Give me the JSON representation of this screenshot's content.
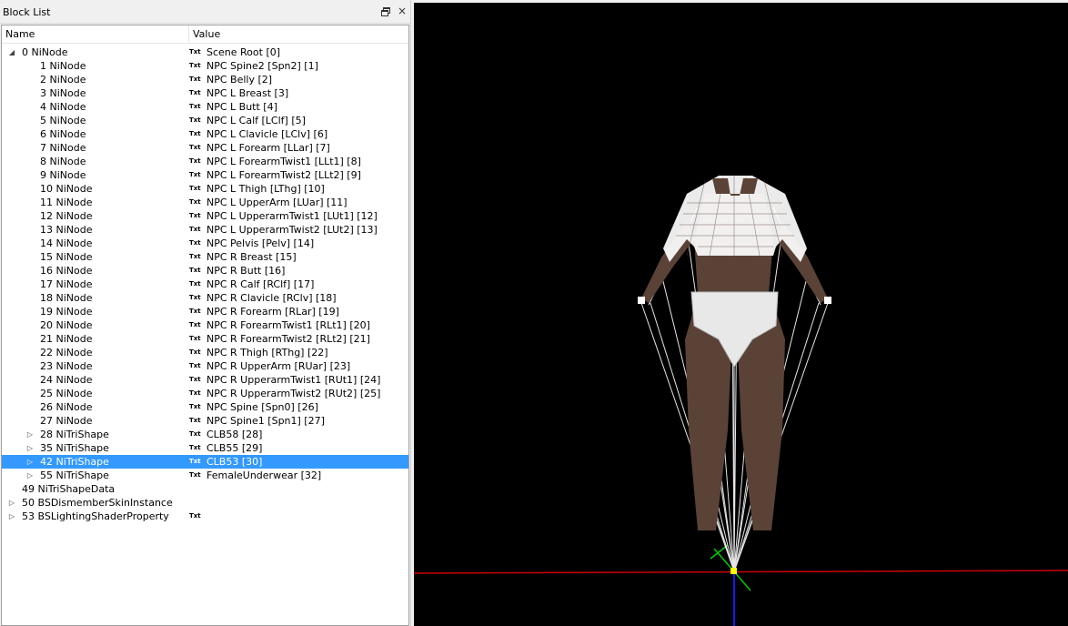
{
  "panel": {
    "title": "Block List",
    "float_icon": "restore-window-icon",
    "close_icon": "close-icon",
    "close_glyph": "×"
  },
  "tree": {
    "columns": {
      "name": "Name",
      "value": "Value"
    },
    "txt_badge": "Txt",
    "rows": [
      {
        "name": "0 NiNode",
        "value": "Scene Root [0]",
        "txt": true,
        "level": 0,
        "arrow": "expanded"
      },
      {
        "name": "1 NiNode",
        "value": "NPC Spine2 [Spn2] [1]",
        "txt": true,
        "level": 1
      },
      {
        "name": "2 NiNode",
        "value": "NPC Belly [2]",
        "txt": true,
        "level": 1
      },
      {
        "name": "3 NiNode",
        "value": "NPC L Breast [3]",
        "txt": true,
        "level": 1
      },
      {
        "name": "4 NiNode",
        "value": "NPC L Butt [4]",
        "txt": true,
        "level": 1
      },
      {
        "name": "5 NiNode",
        "value": "NPC L Calf [LClf] [5]",
        "txt": true,
        "level": 1
      },
      {
        "name": "6 NiNode",
        "value": "NPC L Clavicle [LClv] [6]",
        "txt": true,
        "level": 1
      },
      {
        "name": "7 NiNode",
        "value": "NPC L Forearm [LLar] [7]",
        "txt": true,
        "level": 1
      },
      {
        "name": "8 NiNode",
        "value": "NPC L ForearmTwist1 [LLt1] [8]",
        "txt": true,
        "level": 1
      },
      {
        "name": "9 NiNode",
        "value": "NPC L ForearmTwist2 [LLt2] [9]",
        "txt": true,
        "level": 1
      },
      {
        "name": "10 NiNode",
        "value": "NPC L Thigh [LThg] [10]",
        "txt": true,
        "level": 1
      },
      {
        "name": "11 NiNode",
        "value": "NPC L UpperArm [LUar] [11]",
        "txt": true,
        "level": 1
      },
      {
        "name": "12 NiNode",
        "value": "NPC L UpperarmTwist1 [LUt1] [12]",
        "txt": true,
        "level": 1
      },
      {
        "name": "13 NiNode",
        "value": "NPC L UpperarmTwist2 [LUt2] [13]",
        "txt": true,
        "level": 1
      },
      {
        "name": "14 NiNode",
        "value": "NPC Pelvis [Pelv] [14]",
        "txt": true,
        "level": 1
      },
      {
        "name": "15 NiNode",
        "value": "NPC R Breast [15]",
        "txt": true,
        "level": 1
      },
      {
        "name": "16 NiNode",
        "value": "NPC R Butt [16]",
        "txt": true,
        "level": 1
      },
      {
        "name": "17 NiNode",
        "value": "NPC R Calf [RClf] [17]",
        "txt": true,
        "level": 1
      },
      {
        "name": "18 NiNode",
        "value": "NPC R Clavicle [RClv] [18]",
        "txt": true,
        "level": 1
      },
      {
        "name": "19 NiNode",
        "value": "NPC R Forearm [RLar] [19]",
        "txt": true,
        "level": 1
      },
      {
        "name": "20 NiNode",
        "value": "NPC R ForearmTwist1 [RLt1] [20]",
        "txt": true,
        "level": 1
      },
      {
        "name": "21 NiNode",
        "value": "NPC R ForearmTwist2 [RLt2] [21]",
        "txt": true,
        "level": 1
      },
      {
        "name": "22 NiNode",
        "value": "NPC R Thigh [RThg] [22]",
        "txt": true,
        "level": 1
      },
      {
        "name": "23 NiNode",
        "value": "NPC R UpperArm [RUar] [23]",
        "txt": true,
        "level": 1
      },
      {
        "name": "24 NiNode",
        "value": "NPC R UpperarmTwist1 [RUt1] [24]",
        "txt": true,
        "level": 1
      },
      {
        "name": "25 NiNode",
        "value": "NPC R UpperarmTwist2 [RUt2] [25]",
        "txt": true,
        "level": 1
      },
      {
        "name": "26 NiNode",
        "value": "NPC Spine [Spn0] [26]",
        "txt": true,
        "level": 1
      },
      {
        "name": "27 NiNode",
        "value": "NPC Spine1 [Spn1] [27]",
        "txt": true,
        "level": 1
      },
      {
        "name": "28 NiTriShape",
        "value": "CLB58 [28]",
        "txt": true,
        "level": 1,
        "arrow": "collapsed"
      },
      {
        "name": "35 NiTriShape",
        "value": "CLB55 [29]",
        "txt": true,
        "level": 1,
        "arrow": "collapsed"
      },
      {
        "name": "42 NiTriShape",
        "value": "CLB53 [30]",
        "txt": true,
        "level": 1,
        "arrow": "collapsed",
        "selected": true
      },
      {
        "name": "55 NiTriShape",
        "value": "FemaleUnderwear [32]",
        "txt": true,
        "level": 1,
        "arrow": "collapsed"
      },
      {
        "name": "49 NiTriShapeData",
        "value": "",
        "txt": false,
        "level": 0
      },
      {
        "name": "50 BSDismemberSkinInstance",
        "value": "",
        "txt": false,
        "level": 0,
        "arrow": "collapsed",
        "root_arrow": true
      },
      {
        "name": "53 BSLightingShaderProperty",
        "value": "",
        "txt": true,
        "level": 0,
        "arrow": "collapsed",
        "root_arrow": true
      }
    ]
  },
  "viewport": {
    "background": "#000000",
    "axis_colors": {
      "x": "#cc0000",
      "y": "#00cc00",
      "z": "#0000cc",
      "origin": "#ffff00"
    },
    "skin_color": "#5a4237",
    "mesh_color": "#ffffff",
    "underwear_color": "#e8e8e8"
  },
  "colors": {
    "selection": "#3399ff",
    "panel_bg": "#f0f0f0"
  }
}
